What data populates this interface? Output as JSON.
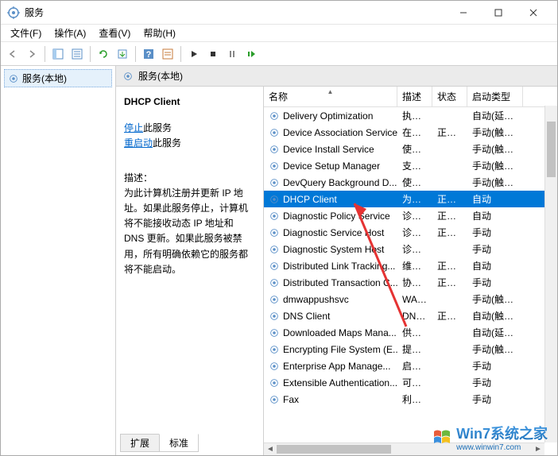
{
  "window": {
    "title": "服务"
  },
  "menu": {
    "file": "文件(F)",
    "action": "操作(A)",
    "view": "查看(V)",
    "help": "帮助(H)"
  },
  "tree": {
    "root": "服务(本地)"
  },
  "contentHeader": "服务(本地)",
  "detail": {
    "serviceName": "DHCP Client",
    "stopLink": "停止",
    "stopSuffix": "此服务",
    "restartLink": "重启动",
    "restartSuffix": "此服务",
    "descLabel": "描述：",
    "descText": "为此计算机注册并更新 IP 地址。如果此服务停止，计算机将不能接收动态 IP 地址和 DNS 更新。如果此服务被禁用，所有明确依赖它的服务都将不能启动。"
  },
  "columns": {
    "name": "名称",
    "desc": "描述",
    "status": "状态",
    "start": "启动类型"
  },
  "services": [
    {
      "name": "Delivery Optimization",
      "desc": "执行...",
      "status": "",
      "start": "自动(延迟..."
    },
    {
      "name": "Device Association Service",
      "desc": "在系...",
      "status": "正在...",
      "start": "手动(触发..."
    },
    {
      "name": "Device Install Service",
      "desc": "使计...",
      "status": "",
      "start": "手动(触发..."
    },
    {
      "name": "Device Setup Manager",
      "desc": "支持...",
      "status": "",
      "start": "手动(触发..."
    },
    {
      "name": "DevQuery Background D...",
      "desc": "使应...",
      "status": "",
      "start": "手动(触发..."
    },
    {
      "name": "DHCP Client",
      "desc": "为此...",
      "status": "正在...",
      "start": "自动",
      "selected": true
    },
    {
      "name": "Diagnostic Policy Service",
      "desc": "诊断...",
      "status": "正在...",
      "start": "自动"
    },
    {
      "name": "Diagnostic Service Host",
      "desc": "诊断...",
      "status": "正在...",
      "start": "手动"
    },
    {
      "name": "Diagnostic System Host",
      "desc": "诊断...",
      "status": "",
      "start": "手动"
    },
    {
      "name": "Distributed Link Tracking...",
      "desc": "维护...",
      "status": "正在...",
      "start": "自动"
    },
    {
      "name": "Distributed Transaction C...",
      "desc": "协调...",
      "status": "正在...",
      "start": "手动"
    },
    {
      "name": "dmwappushsvc",
      "desc": "WAP...",
      "status": "",
      "start": "手动(触发..."
    },
    {
      "name": "DNS Client",
      "desc": "DNS...",
      "status": "正在...",
      "start": "自动(触发..."
    },
    {
      "name": "Downloaded Maps Mana...",
      "desc": "供应...",
      "status": "",
      "start": "自动(延迟..."
    },
    {
      "name": "Encrypting File System (E...",
      "desc": "提供...",
      "status": "",
      "start": "手动(触发..."
    },
    {
      "name": "Enterprise App Manage...",
      "desc": "启用...",
      "status": "",
      "start": "手动"
    },
    {
      "name": "Extensible Authentication...",
      "desc": "可扩...",
      "status": "",
      "start": "手动"
    },
    {
      "name": "Fax",
      "desc": "利用...",
      "status": "",
      "start": "手动"
    }
  ],
  "tabs": {
    "extended": "扩展",
    "standard": "标准"
  },
  "watermark": {
    "brand": "Win7系统之家",
    "url": "www.winwin7.com"
  }
}
